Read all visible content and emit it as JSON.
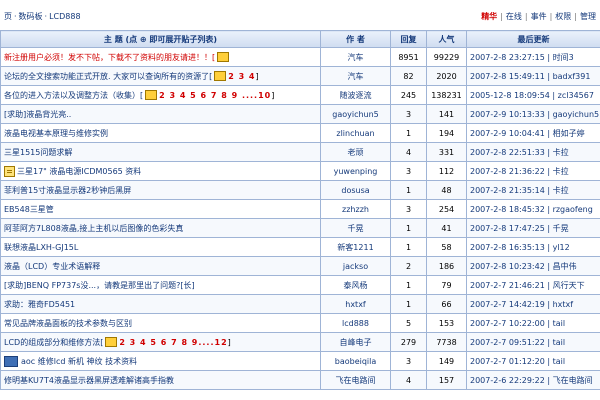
{
  "breadcrumb": {
    "home": "页",
    "section": "数码板",
    "forum": "LCD888"
  },
  "topnav": {
    "items": [
      "精华",
      "在线",
      "事件",
      "权限",
      "管理"
    ]
  },
  "table": {
    "headers": {
      "title": "主 题 (点 ⊕ 即可展开贴子列表)",
      "author": "作 者",
      "replies": "回复",
      "views": "人气",
      "last": "最后更新"
    },
    "rows": [
      {
        "title": "新注册用户必须！发不下帖，下载不了资料的朋友请进！！[",
        "style": "red",
        "icon": "none",
        "ttl_icon": true,
        "pages": "",
        "page_suffix": "",
        "author": "汽车",
        "replies": "8951",
        "views": "99229",
        "last": "2007-2-8 23:27:15 | 时间3"
      },
      {
        "title": "论坛的全文搜索功能正式开放. 大家可以查询所有的资源了[",
        "style": "normal",
        "icon": "none",
        "ttl_icon": true,
        "pages": "2 3 4",
        "page_suffix": "]",
        "author": "汽车",
        "replies": "82",
        "views": "2020",
        "last": "2007-2-8 15:49:11 | badxf391"
      },
      {
        "title": "各位的进入方法以及调整方法（收集）[",
        "style": "normal",
        "icon": "none",
        "ttl_icon": true,
        "pages": "2 3 4 5 6 7 8 9 ....10",
        "page_suffix": "]",
        "author": "随波逐流",
        "replies": "245",
        "views": "138231",
        "last": "2005-12-8 18:09:54 | zcl34567"
      },
      {
        "title": "[求助]液晶背光亮..",
        "style": "normal",
        "icon": "none",
        "ttl_icon": false,
        "pages": "",
        "page_suffix": "",
        "author": "gaoyichun5",
        "replies": "3",
        "views": "141",
        "last": "2007-2-9 10:13:33 | gaoyichun5"
      },
      {
        "title": "液晶电视基本原理与维修实例",
        "style": "normal",
        "icon": "none",
        "ttl_icon": false,
        "pages": "",
        "page_suffix": "",
        "author": "zlinchuan",
        "replies": "1",
        "views": "194",
        "last": "2007-2-9 10:04:41 | 相如子婷"
      },
      {
        "title": "三星1515问题求解",
        "style": "normal",
        "icon": "none",
        "ttl_icon": false,
        "pages": "",
        "page_suffix": "",
        "author": "老顽",
        "replies": "4",
        "views": "331",
        "last": "2007-2-8 22:51:33 | 卡拉"
      },
      {
        "title": "三星17\" 液晶电源ICDM0565 资料",
        "style": "normal",
        "icon": "doc",
        "ttl_icon": false,
        "pages": "",
        "page_suffix": "",
        "author": "yuwenping",
        "replies": "3",
        "views": "112",
        "last": "2007-2-8 21:36:22 | 卡拉"
      },
      {
        "title": "菲利普15寸液晶显示器2秒钟后黑屏",
        "style": "normal",
        "icon": "none",
        "ttl_icon": false,
        "pages": "",
        "page_suffix": "",
        "author": "dosusa",
        "replies": "1",
        "views": "48",
        "last": "2007-2-8 21:35:14 | 卡拉"
      },
      {
        "title": "EB548三星管",
        "style": "normal",
        "icon": "none",
        "ttl_icon": false,
        "pages": "",
        "page_suffix": "",
        "author": "zzhzzh",
        "replies": "3",
        "views": "254",
        "last": "2007-2-8 18:45:32 | rzgaofeng"
      },
      {
        "title": "阿菲阿方7L808液晶,接上主机以后图像的色彩失真",
        "style": "normal",
        "icon": "none",
        "ttl_icon": false,
        "pages": "",
        "page_suffix": "",
        "author": "千晃",
        "replies": "1",
        "views": "41",
        "last": "2007-2-8 17:47:25 | 千晃"
      },
      {
        "title": "联想液晶LXH-GJ15L",
        "style": "normal",
        "icon": "none",
        "ttl_icon": false,
        "pages": "",
        "page_suffix": "",
        "author": "新客1211",
        "replies": "1",
        "views": "58",
        "last": "2007-2-8 16:35:13 | yl12"
      },
      {
        "title": "液晶（LCD）专业术语解释",
        "style": "normal",
        "icon": "none",
        "ttl_icon": false,
        "pages": "",
        "page_suffix": "",
        "author": "jackso",
        "replies": "2",
        "views": "186",
        "last": "2007-2-8 10:23:42 | 昌中伟"
      },
      {
        "title": "[求助]BENQ FP737s没...，请教是那里出了问题?[长]",
        "style": "normal",
        "icon": "none",
        "ttl_icon": false,
        "pages": "",
        "page_suffix": "",
        "author": "泰风杨",
        "replies": "1",
        "views": "79",
        "last": "2007-2-7 21:46:21 | 风行天下"
      },
      {
        "title": "求助：雅奇FD5451",
        "style": "normal",
        "icon": "none",
        "ttl_icon": false,
        "pages": "",
        "page_suffix": "",
        "author": "hxtxf",
        "replies": "1",
        "views": "66",
        "last": "2007-2-7 14:42:19 | hxtxf"
      },
      {
        "title": "常见品牌液晶面板的技术参数与区别",
        "style": "normal",
        "icon": "none",
        "ttl_icon": false,
        "pages": "",
        "page_suffix": "",
        "author": "lcd888",
        "replies": "5",
        "views": "153",
        "last": "2007-2-7 10:22:00 | tail"
      },
      {
        "title": "LCD的组成部分和维修方法[",
        "style": "normal",
        "icon": "none",
        "ttl_icon": true,
        "pages": "2 3 4 5 6 7 8 9....12",
        "page_suffix": "]",
        "author": "自峰电子",
        "replies": "279",
        "views": "7738",
        "last": "2007-2-7 09:51:22 | tail"
      },
      {
        "title": "aoc 维修lcd 新机 神纹 技术资料",
        "style": "normal",
        "icon": "mon",
        "ttl_icon": false,
        "pages": "",
        "page_suffix": "",
        "author": "baobeiqila",
        "replies": "3",
        "views": "149",
        "last": "2007-2-7 01:12:20 | tail"
      },
      {
        "title": "修明基KU7T4液晶显示器黑屏透难解诸高手指教",
        "style": "normal",
        "icon": "none",
        "ttl_icon": false,
        "pages": "",
        "page_suffix": "",
        "author": "飞在电路间",
        "replies": "4",
        "views": "157",
        "last": "2007-2-6 22:29:22 | 飞在电路间"
      }
    ]
  }
}
